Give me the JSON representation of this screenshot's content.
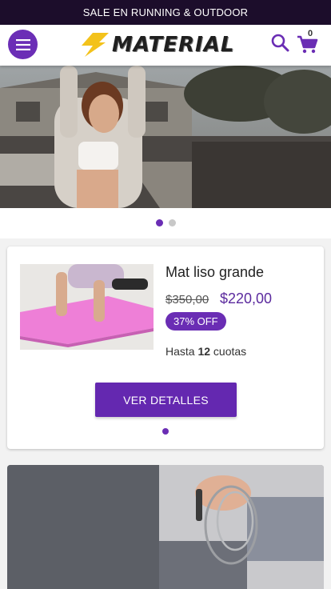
{
  "promo": {
    "text": "SALE EN RUNNING & OUTDOOR"
  },
  "header": {
    "brand": "MATERIAL",
    "cart_count": "0",
    "icons": {
      "menu": "hamburger-menu-icon",
      "search": "search-icon",
      "cart": "shopping-cart-icon",
      "logo": "lightning-bolt-icon"
    }
  },
  "hero": {
    "slides": 2,
    "active_slide": 1,
    "image": "woman-stretching-outdoor-photo"
  },
  "product": {
    "name": "Mat liso grande",
    "old_price": "$350,00",
    "price": "$220,00",
    "discount": "37% OFF",
    "installments_prefix": "Hasta ",
    "installments_count": "12",
    "installments_suffix": " cuotas",
    "button": "VER DETALLES",
    "image": "yoga-mat-photo"
  },
  "banner2": {
    "image": "jump-rope-photo"
  },
  "colors": {
    "accent": "#6a2db4",
    "promo_bg": "#1c0d2b",
    "dot_inactive": "#c8c8c8"
  }
}
